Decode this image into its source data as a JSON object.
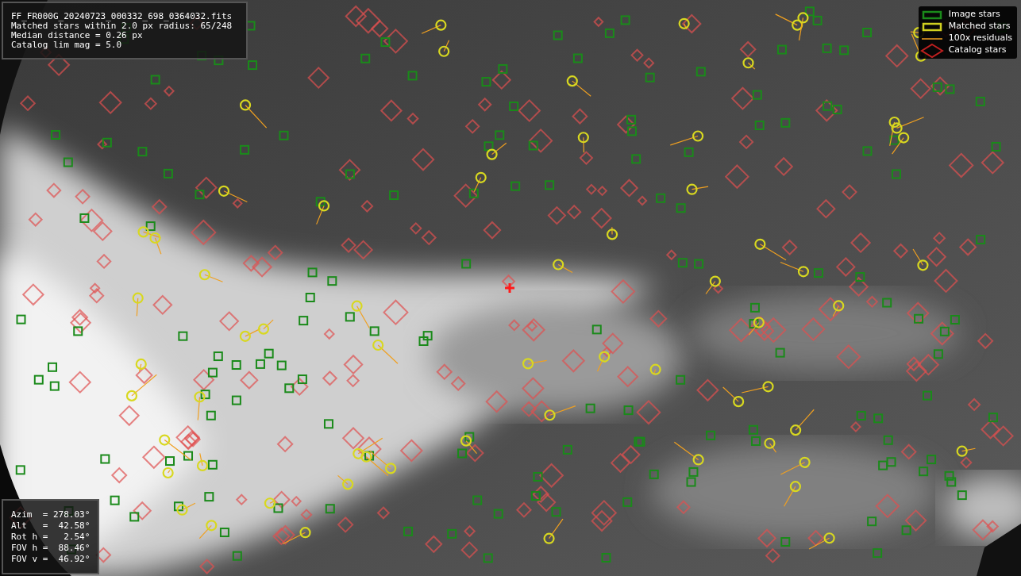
{
  "info_box": {
    "lines": [
      "FF_FR000G_20240723_000332_698_0364032.fits",
      "Matched stars within 2.0 px radius: 65/248",
      "Median distance = 0.26 px",
      "Catalog lim mag = 5.0"
    ]
  },
  "legend": {
    "items": [
      {
        "label": "Image stars"
      },
      {
        "kind": "matched",
        "label": "Matched stars"
      },
      {
        "kind": "residual",
        "label": "100x residuals"
      },
      {
        "kind": "catalog",
        "label": "Catalog stars"
      }
    ]
  },
  "pointing_box": {
    "lines": [
      "Azim  = 278.03°",
      "Alt   =  42.58°",
      "Rot h =   2.54°",
      "FOV h =  88.46°",
      "FOV v =  46.92°"
    ]
  }
}
